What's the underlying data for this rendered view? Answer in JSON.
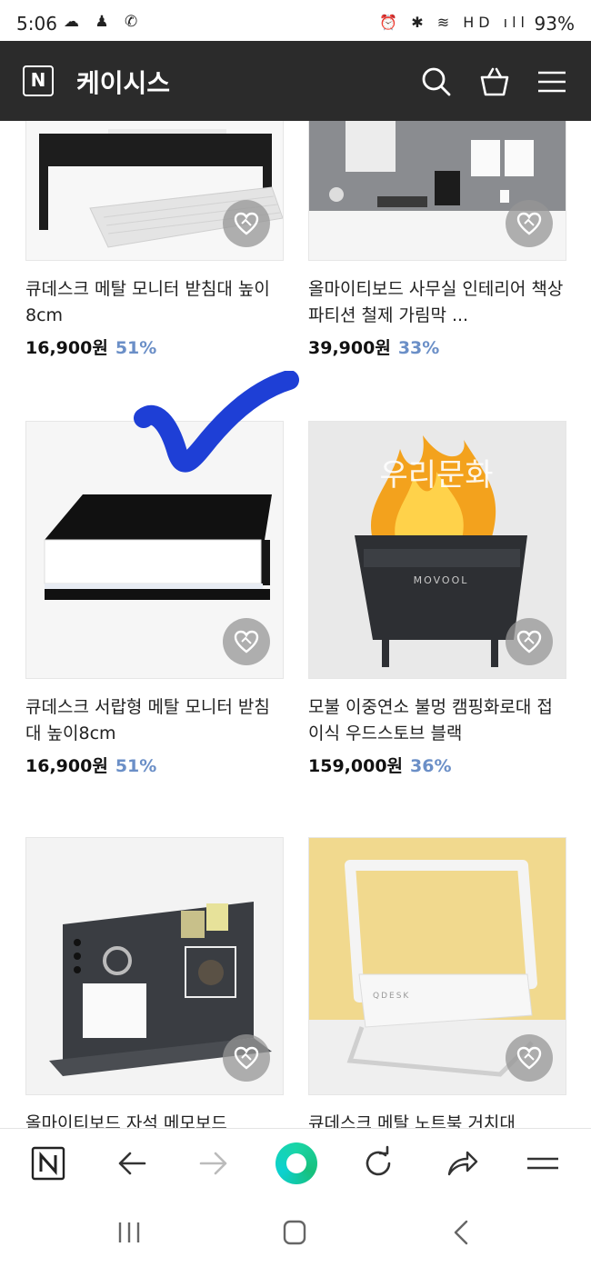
{
  "status": {
    "time": "5:06",
    "left_icons": "☁ ♟ ✆",
    "right_icons": "⏰ ✱ ≋ HD ıll",
    "battery": "93%"
  },
  "header": {
    "logo": "N",
    "title": "케이시스"
  },
  "products": [
    {
      "name": "큐데스크 메탈 모니터 받침대 높이8cm",
      "price": "16,900원",
      "discount": "51%"
    },
    {
      "name": "올마이티보드 사무실 인테리어 책상파티션 철제 가림막 ...",
      "price": "39,900원",
      "discount": "33%"
    },
    {
      "name": "큐데스크 서랍형 메탈 모니터 받침대 높이8cm",
      "price": "16,900원",
      "discount": "51%"
    },
    {
      "name": "모불 이중연소 불멍 캠핑화로대 접이식 우드스토브 블랙",
      "price": "159,000원",
      "discount": "36%"
    },
    {
      "name": "올마이티보드 자석 메모보드",
      "price": "",
      "discount": ""
    },
    {
      "name": "큐데스크 메탈 노트북 거치대",
      "price": "",
      "discount": ""
    }
  ],
  "image_text": {
    "firepit_brand": "MOVOOL",
    "firepit_caption": "우리문화",
    "stand_brand": "QDESK"
  },
  "browser_bar": {
    "logo": "N"
  },
  "colors": {
    "header_bg": "#2b2b2b",
    "discount": "#6b8fc7",
    "checkmark": "#1e3fd6"
  }
}
